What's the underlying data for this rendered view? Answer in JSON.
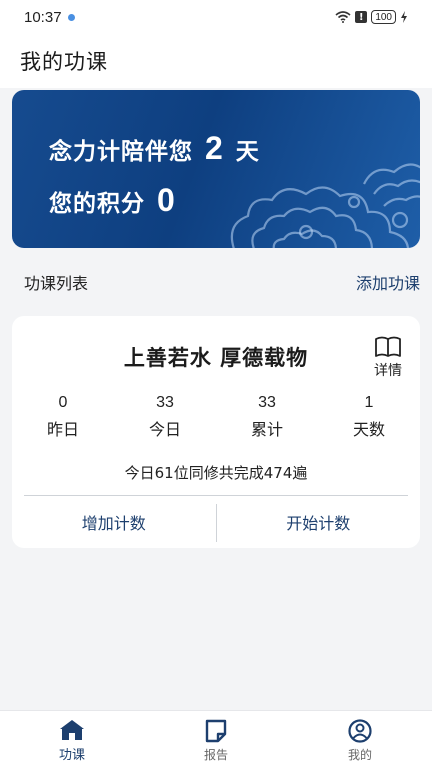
{
  "status": {
    "time": "10:37",
    "battery": "100"
  },
  "header": {
    "title": "我的功课"
  },
  "banner": {
    "line1_prefix": "念力计陪伴您",
    "days": "2",
    "line1_suffix": "天",
    "line2_prefix": "您的积分",
    "points": "0"
  },
  "section": {
    "title": "功课列表",
    "add_label": "添加功课"
  },
  "card": {
    "title": "上善若水 厚德载物",
    "detail_label": "详情",
    "stats": [
      {
        "value": "0",
        "label": "昨日"
      },
      {
        "value": "33",
        "label": "今日"
      },
      {
        "value": "33",
        "label": "累计"
      },
      {
        "value": "1",
        "label": "天数"
      }
    ],
    "progress_text": "今日61位同修共完成474遍",
    "add_count_label": "增加计数",
    "start_count_label": "开始计数"
  },
  "tabs": [
    {
      "label": "功课",
      "icon": "home-icon",
      "active": true
    },
    {
      "label": "报告",
      "icon": "report-icon",
      "active": false
    },
    {
      "label": "我的",
      "icon": "profile-icon",
      "active": false
    }
  ],
  "colors": {
    "accent": "#1d3f6e",
    "banner": "#164b8f",
    "background": "#f3f4f6"
  }
}
